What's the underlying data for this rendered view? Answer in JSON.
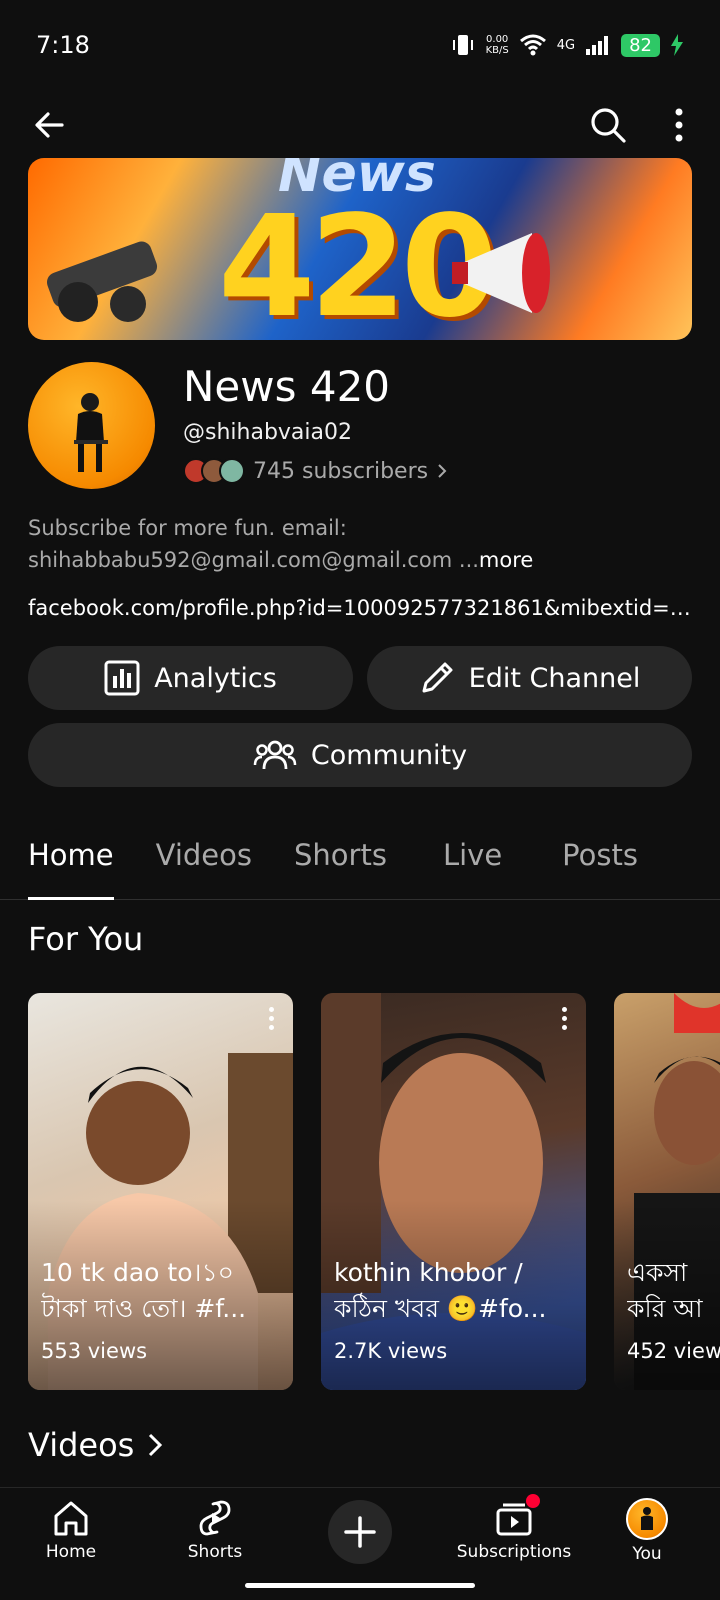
{
  "status_bar": {
    "time": "7:18",
    "speed_value": "0.00",
    "speed_unit": "KB/S",
    "network": "4G",
    "battery": "82"
  },
  "topbar": {
    "back_icon": "arrow-left-icon",
    "search_icon": "search-icon",
    "more_icon": "more-vert-icon"
  },
  "banner": {
    "big_text": "420",
    "sub_text": "News"
  },
  "channel": {
    "name": "News 420",
    "handle": "@shihabvaia02",
    "subscribers": "745 subscribers",
    "description": "Subscribe for more fun.  email: shihabbabu592@gmail.com@gmail.com ...",
    "more_label": "more",
    "link": "facebook.com/profile.php?id=100092577321861&mibextid=Z..."
  },
  "actions": {
    "analytics": "Analytics",
    "edit_channel": "Edit Channel",
    "community": "Community"
  },
  "tabs": [
    {
      "label": "Home",
      "active": true
    },
    {
      "label": "Videos",
      "active": false
    },
    {
      "label": "Shorts",
      "active": false
    },
    {
      "label": "Live",
      "active": false
    },
    {
      "label": "Posts",
      "active": false
    }
  ],
  "for_you": {
    "title": "For You",
    "shorts": [
      {
        "title": "10 tk dao to।১০\nটাকা দাও তো। #f...",
        "views": "553 views"
      },
      {
        "title": "kothin khobor  /\nকঠিন খবর 🙂#fo...",
        "views": "2.7K views"
      },
      {
        "title": "একসা\nকরি আ",
        "views": "452 view"
      }
    ]
  },
  "videos_section": {
    "title": "Videos"
  },
  "bottom_nav": {
    "home": "Home",
    "shorts": "Shorts",
    "subscriptions": "Subscriptions",
    "you": "You"
  },
  "colors": {
    "background": "#0f0f0f",
    "button_bg": "#272727",
    "secondary_text": "#aaaaaa",
    "battery_green": "#2ec866",
    "notification_red": "#ff0033"
  }
}
